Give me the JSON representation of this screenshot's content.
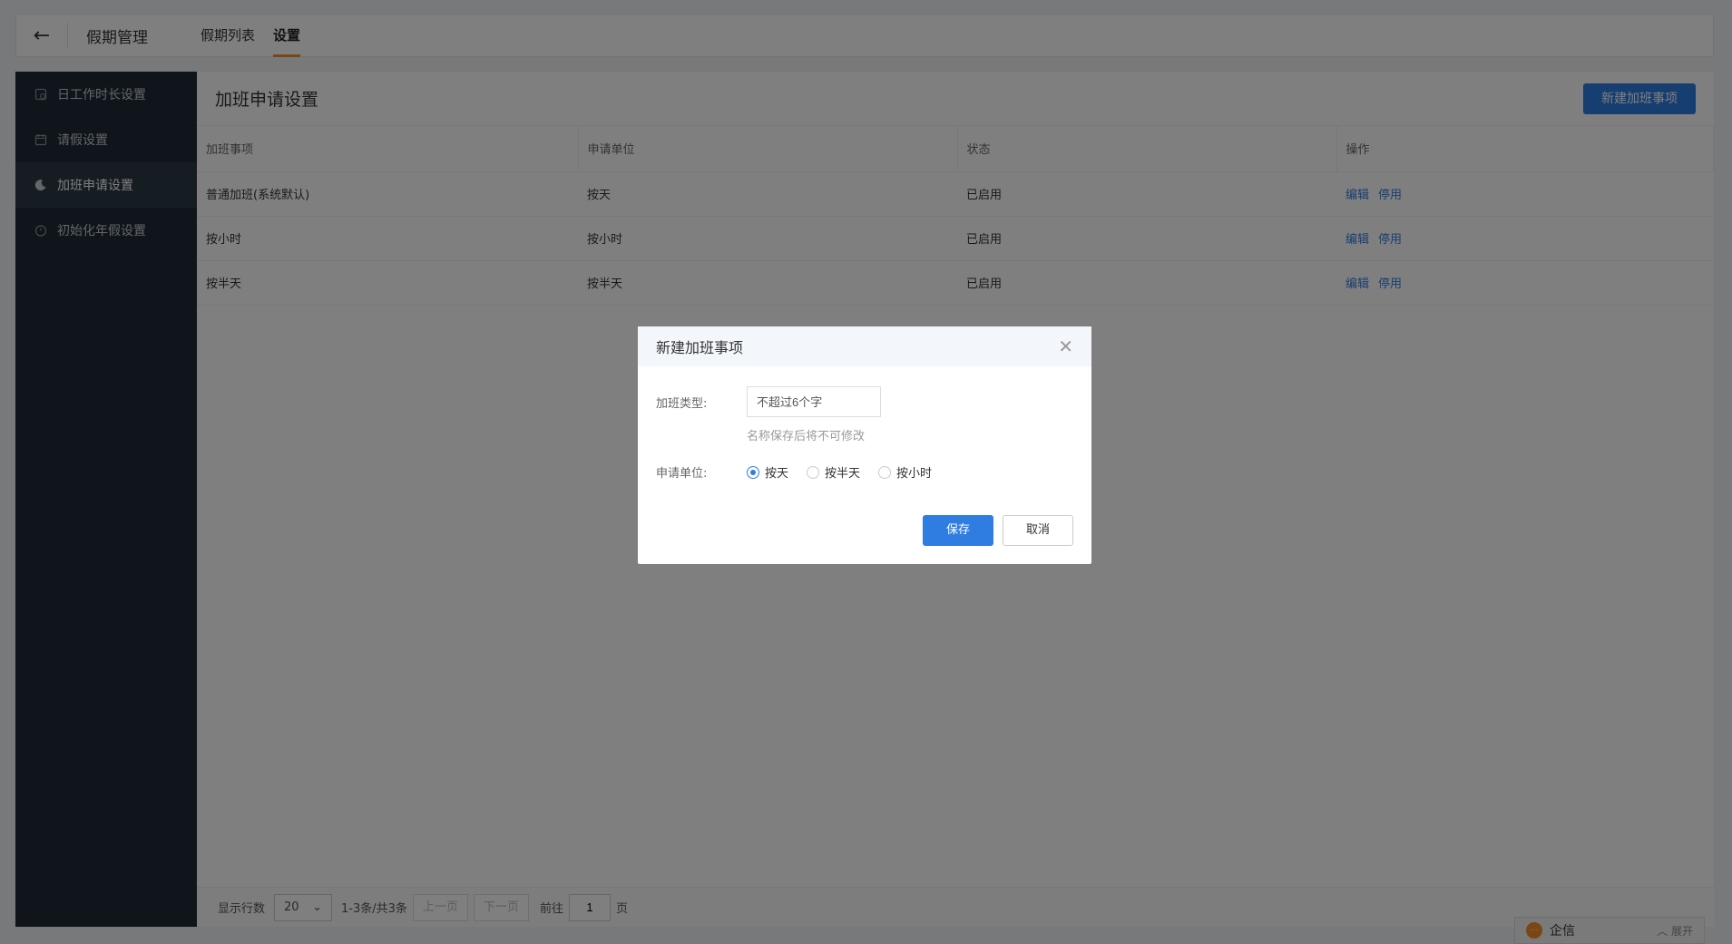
{
  "topbar": {
    "back_icon": "arrow-left-icon",
    "title": "假期管理",
    "tabs": [
      {
        "label": "假期列表",
        "active": false
      },
      {
        "label": "设置",
        "active": true
      }
    ],
    "active_tab_color": "#f28c28"
  },
  "sidebar": {
    "items": [
      {
        "label": "日工作时长设置",
        "icon": "clock-doc-icon",
        "active": false
      },
      {
        "label": "请假设置",
        "icon": "calendar-icon",
        "active": false
      },
      {
        "label": "加班申请设置",
        "icon": "moon-icon",
        "active": true
      },
      {
        "label": "初始化年假设置",
        "icon": "timer-icon",
        "active": false
      }
    ]
  },
  "main": {
    "title": "加班申请设置",
    "new_button_label": "新建加班事项",
    "table": {
      "headers": [
        "加班事项",
        "申请单位",
        "状态",
        "操作"
      ],
      "rows": [
        {
          "item": "普通加班(系统默认)",
          "unit": "按天",
          "status": "已启用",
          "actions": [
            "编辑",
            "停用"
          ]
        },
        {
          "item": "按小时",
          "unit": "按小时",
          "status": "已启用",
          "actions": [
            "编辑",
            "停用"
          ]
        },
        {
          "item": "按半天",
          "unit": "按半天",
          "status": "已启用",
          "actions": [
            "编辑",
            "停用"
          ]
        }
      ]
    },
    "pagination": {
      "rows_label": "显示行数",
      "rows_per_page": "20",
      "summary": "1-3条/共3条",
      "prev_label": "上一页",
      "next_label": "下一页",
      "goto_label": "前往",
      "page_value": "1",
      "page_suffix": "页"
    }
  },
  "modal": {
    "title": "新建加班事项",
    "type_label": "加班类型:",
    "type_placeholder": "不超过6个字",
    "type_hint": "名称保存后将不可修改",
    "unit_label": "申请单位:",
    "unit_options": [
      {
        "label": "按天",
        "checked": true
      },
      {
        "label": "按半天",
        "checked": false
      },
      {
        "label": "按小时",
        "checked": false
      }
    ],
    "save_label": "保存",
    "cancel_label": "取消"
  },
  "chat_widget": {
    "label": "企信",
    "expand_label": "展开"
  },
  "colors": {
    "primary": "#2f7de1",
    "sidebar_bg": "#1e2a36",
    "accent": "#f28c28"
  }
}
